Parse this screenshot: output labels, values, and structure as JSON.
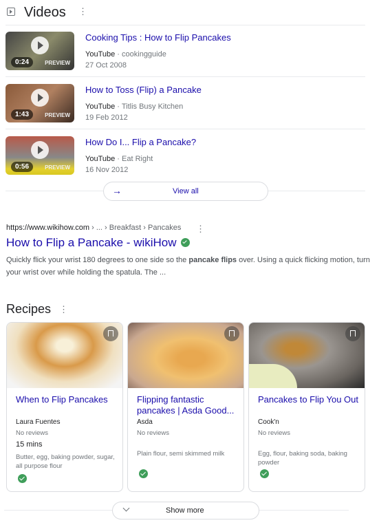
{
  "videos": {
    "header_title": "Videos",
    "items": [
      {
        "title": "Cooking Tips : How to Flip Pancakes",
        "platform": "YouTube",
        "channel": "cookingguide",
        "date": "27 Oct 2008",
        "duration": "0:24",
        "preview": "PREVIEW"
      },
      {
        "title": "How to Toss (Flip) a Pancake",
        "platform": "YouTube",
        "channel": "Titlis Busy Kitchen",
        "date": "19 Feb 2012",
        "duration": "1:43",
        "preview": "PREVIEW"
      },
      {
        "title": "How Do I... Flip a Pancake?",
        "platform": "YouTube",
        "channel": "Eat Right",
        "date": "16 Nov 2012",
        "duration": "0:56",
        "preview": "PREVIEW"
      }
    ],
    "view_all_label": "View all",
    "separator": " · "
  },
  "result": {
    "url": "https://www.wikihow.com",
    "breadcrumb": " › ... › Breakfast › Pancakes",
    "title": "How to Flip a Pancake - wikiHow",
    "snippet_before": "Quickly flick your wrist 180 degrees to one side so the ",
    "snippet_bold": "pancake flips",
    "snippet_after": " over. Using a quick flicking motion, turn your wrist over while holding the spatula. The ..."
  },
  "recipes": {
    "header_title": "Recipes",
    "cards": [
      {
        "title": "When to Flip Pancakes",
        "author": "Laura Fuentes",
        "reviews": "No reviews",
        "time": "15 mins",
        "ingredients": "Butter, egg, baking powder, sugar, all purpose flour"
      },
      {
        "title": "Flipping fantastic pancakes | Asda Good...",
        "author": "Asda",
        "reviews": "No reviews",
        "time": "",
        "ingredients": "Plain flour, semi skimmed milk"
      },
      {
        "title": "Pancakes to Flip You Out",
        "author": "Cook'n",
        "reviews": "No reviews",
        "time": "",
        "ingredients": "Egg, flour, baking soda, baking powder"
      }
    ],
    "show_more_label": "Show more"
  },
  "colors": {
    "link": "#1a0dab",
    "verified": "#1e8e3e"
  }
}
